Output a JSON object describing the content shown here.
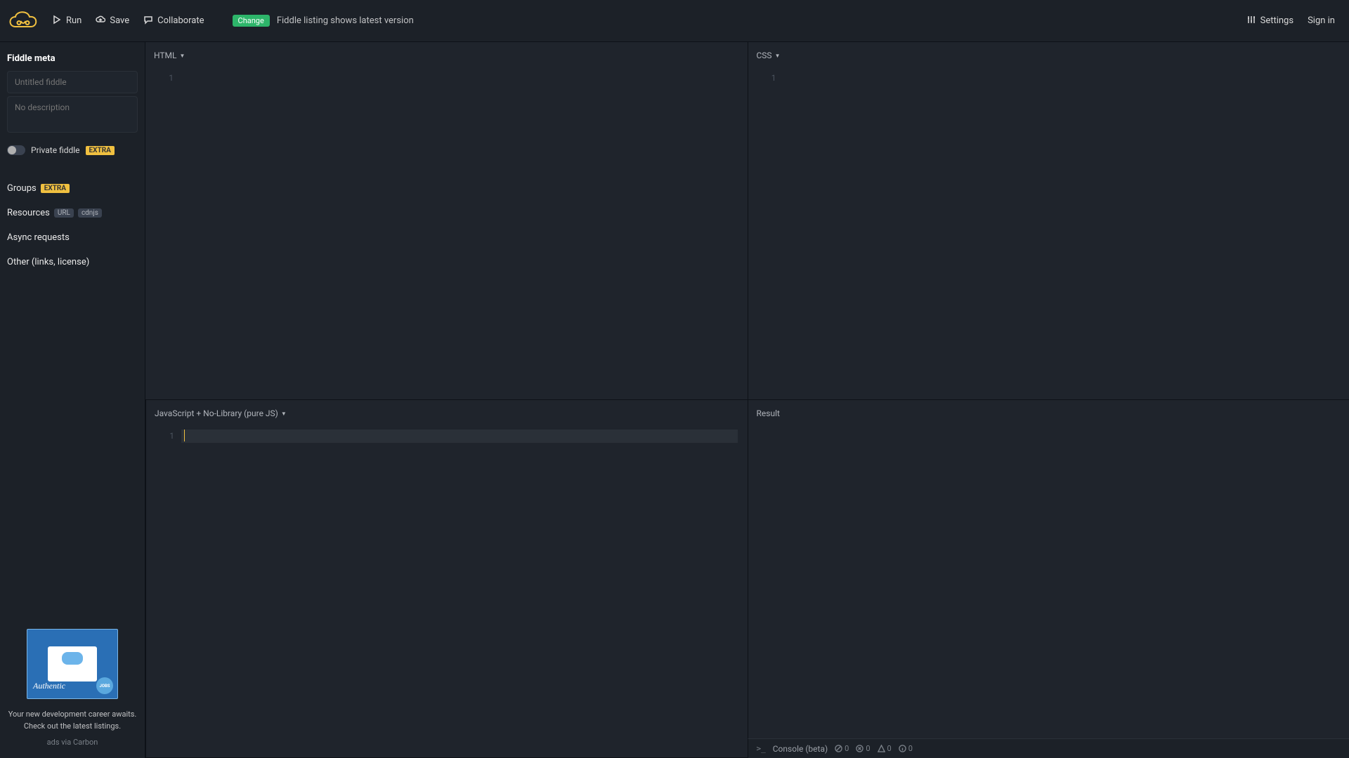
{
  "topbar": {
    "run": "Run",
    "save": "Save",
    "collaborate": "Collaborate",
    "change_badge": "Change",
    "change_text": "Fiddle listing shows latest version",
    "settings": "Settings",
    "signin": "Sign in"
  },
  "sidebar": {
    "meta_title": "Fiddle meta",
    "title_placeholder": "Untitled fiddle",
    "desc_placeholder": "No description",
    "private_label": "Private fiddle",
    "extra_badge": "EXTRA",
    "groups": "Groups",
    "resources": "Resources",
    "url_badge": "URL",
    "cdnjs_badge": "cdnjs",
    "async": "Async requests",
    "other": "Other (links, license)"
  },
  "ad": {
    "script": "Authentic",
    "jobs": "JOBS",
    "text": "Your new development career awaits. Check out the latest listings.",
    "attribution": "ads via Carbon"
  },
  "panes": {
    "html": "HTML",
    "css": "CSS",
    "js": "JavaScript + No-Library (pure JS)",
    "result": "Result"
  },
  "editor": {
    "line1": "1"
  },
  "console": {
    "prompt": ">_",
    "label": "Console (beta)",
    "ban": "0",
    "err": "0",
    "warn": "0",
    "info": "0"
  }
}
